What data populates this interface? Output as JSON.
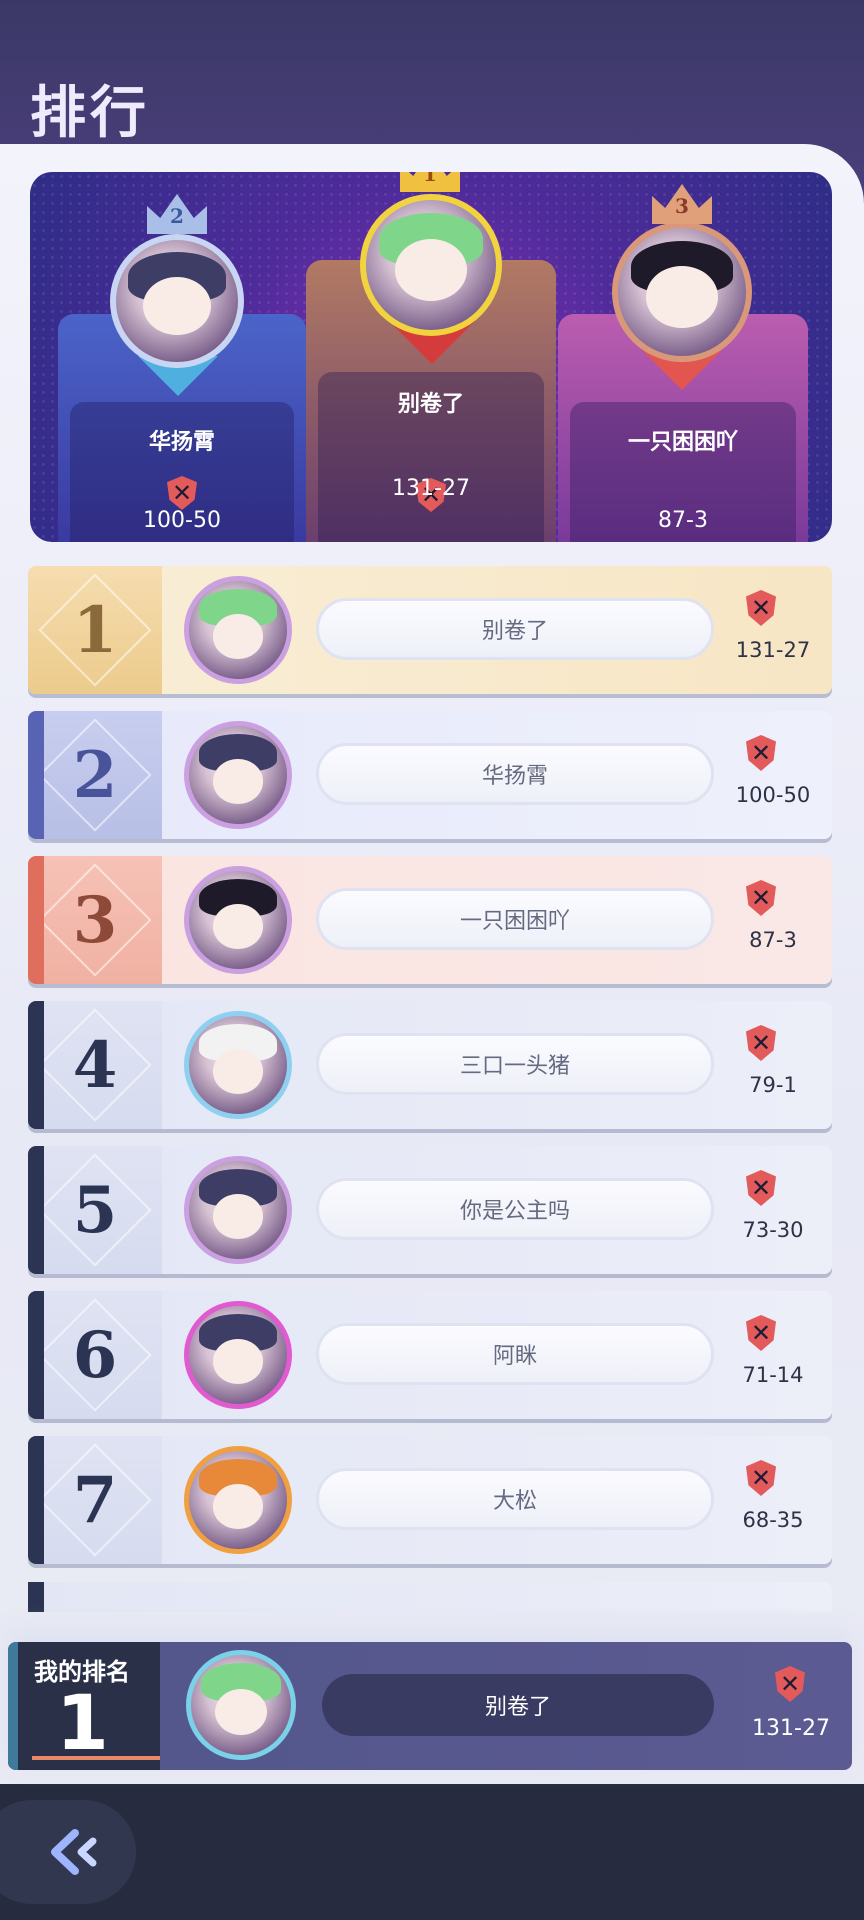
{
  "header": {
    "title": "排行"
  },
  "podium": [
    {
      "place": "2",
      "name": "华扬霄",
      "score": "100-50",
      "hair_color": "#3d3d66"
    },
    {
      "place": "1",
      "name": "别卷了",
      "score": "131-27",
      "hair_color": "#7fd68b"
    },
    {
      "place": "3",
      "name": "一只困困吖",
      "score": "87-3",
      "hair_color": "#1e1a2a"
    }
  ],
  "leaderboard": [
    {
      "rank": "1",
      "name": "别卷了",
      "score": "131-27",
      "hair_color": "#7fd68b"
    },
    {
      "rank": "2",
      "name": "华扬霄",
      "score": "100-50",
      "hair_color": "#3d3d66"
    },
    {
      "rank": "3",
      "name": "一只困困吖",
      "score": "87-3",
      "hair_color": "#1e1a2a"
    },
    {
      "rank": "4",
      "name": "三口一头猪",
      "score": "79-1",
      "hair_color": "#f2f2f2"
    },
    {
      "rank": "5",
      "name": "你是公主吗",
      "score": "73-30",
      "hair_color": "#3d3d66"
    },
    {
      "rank": "6",
      "name": "阿眯",
      "score": "71-14",
      "hair_color": "#3d3d66"
    },
    {
      "rank": "7",
      "name": "大松",
      "score": "68-35",
      "hair_color": "#e8893a"
    }
  ],
  "my_rank": {
    "label": "我的排名",
    "rank": "1",
    "name": "别卷了",
    "score": "131-27"
  },
  "icons": {
    "score_icon": "crossed-swords-shield-icon",
    "back": "back-arrow-icon",
    "crown": "crown-icon"
  },
  "colors": {
    "gold": "#f1d23f",
    "shield": "#e35a5a",
    "accent_dark": "#2b3553"
  }
}
